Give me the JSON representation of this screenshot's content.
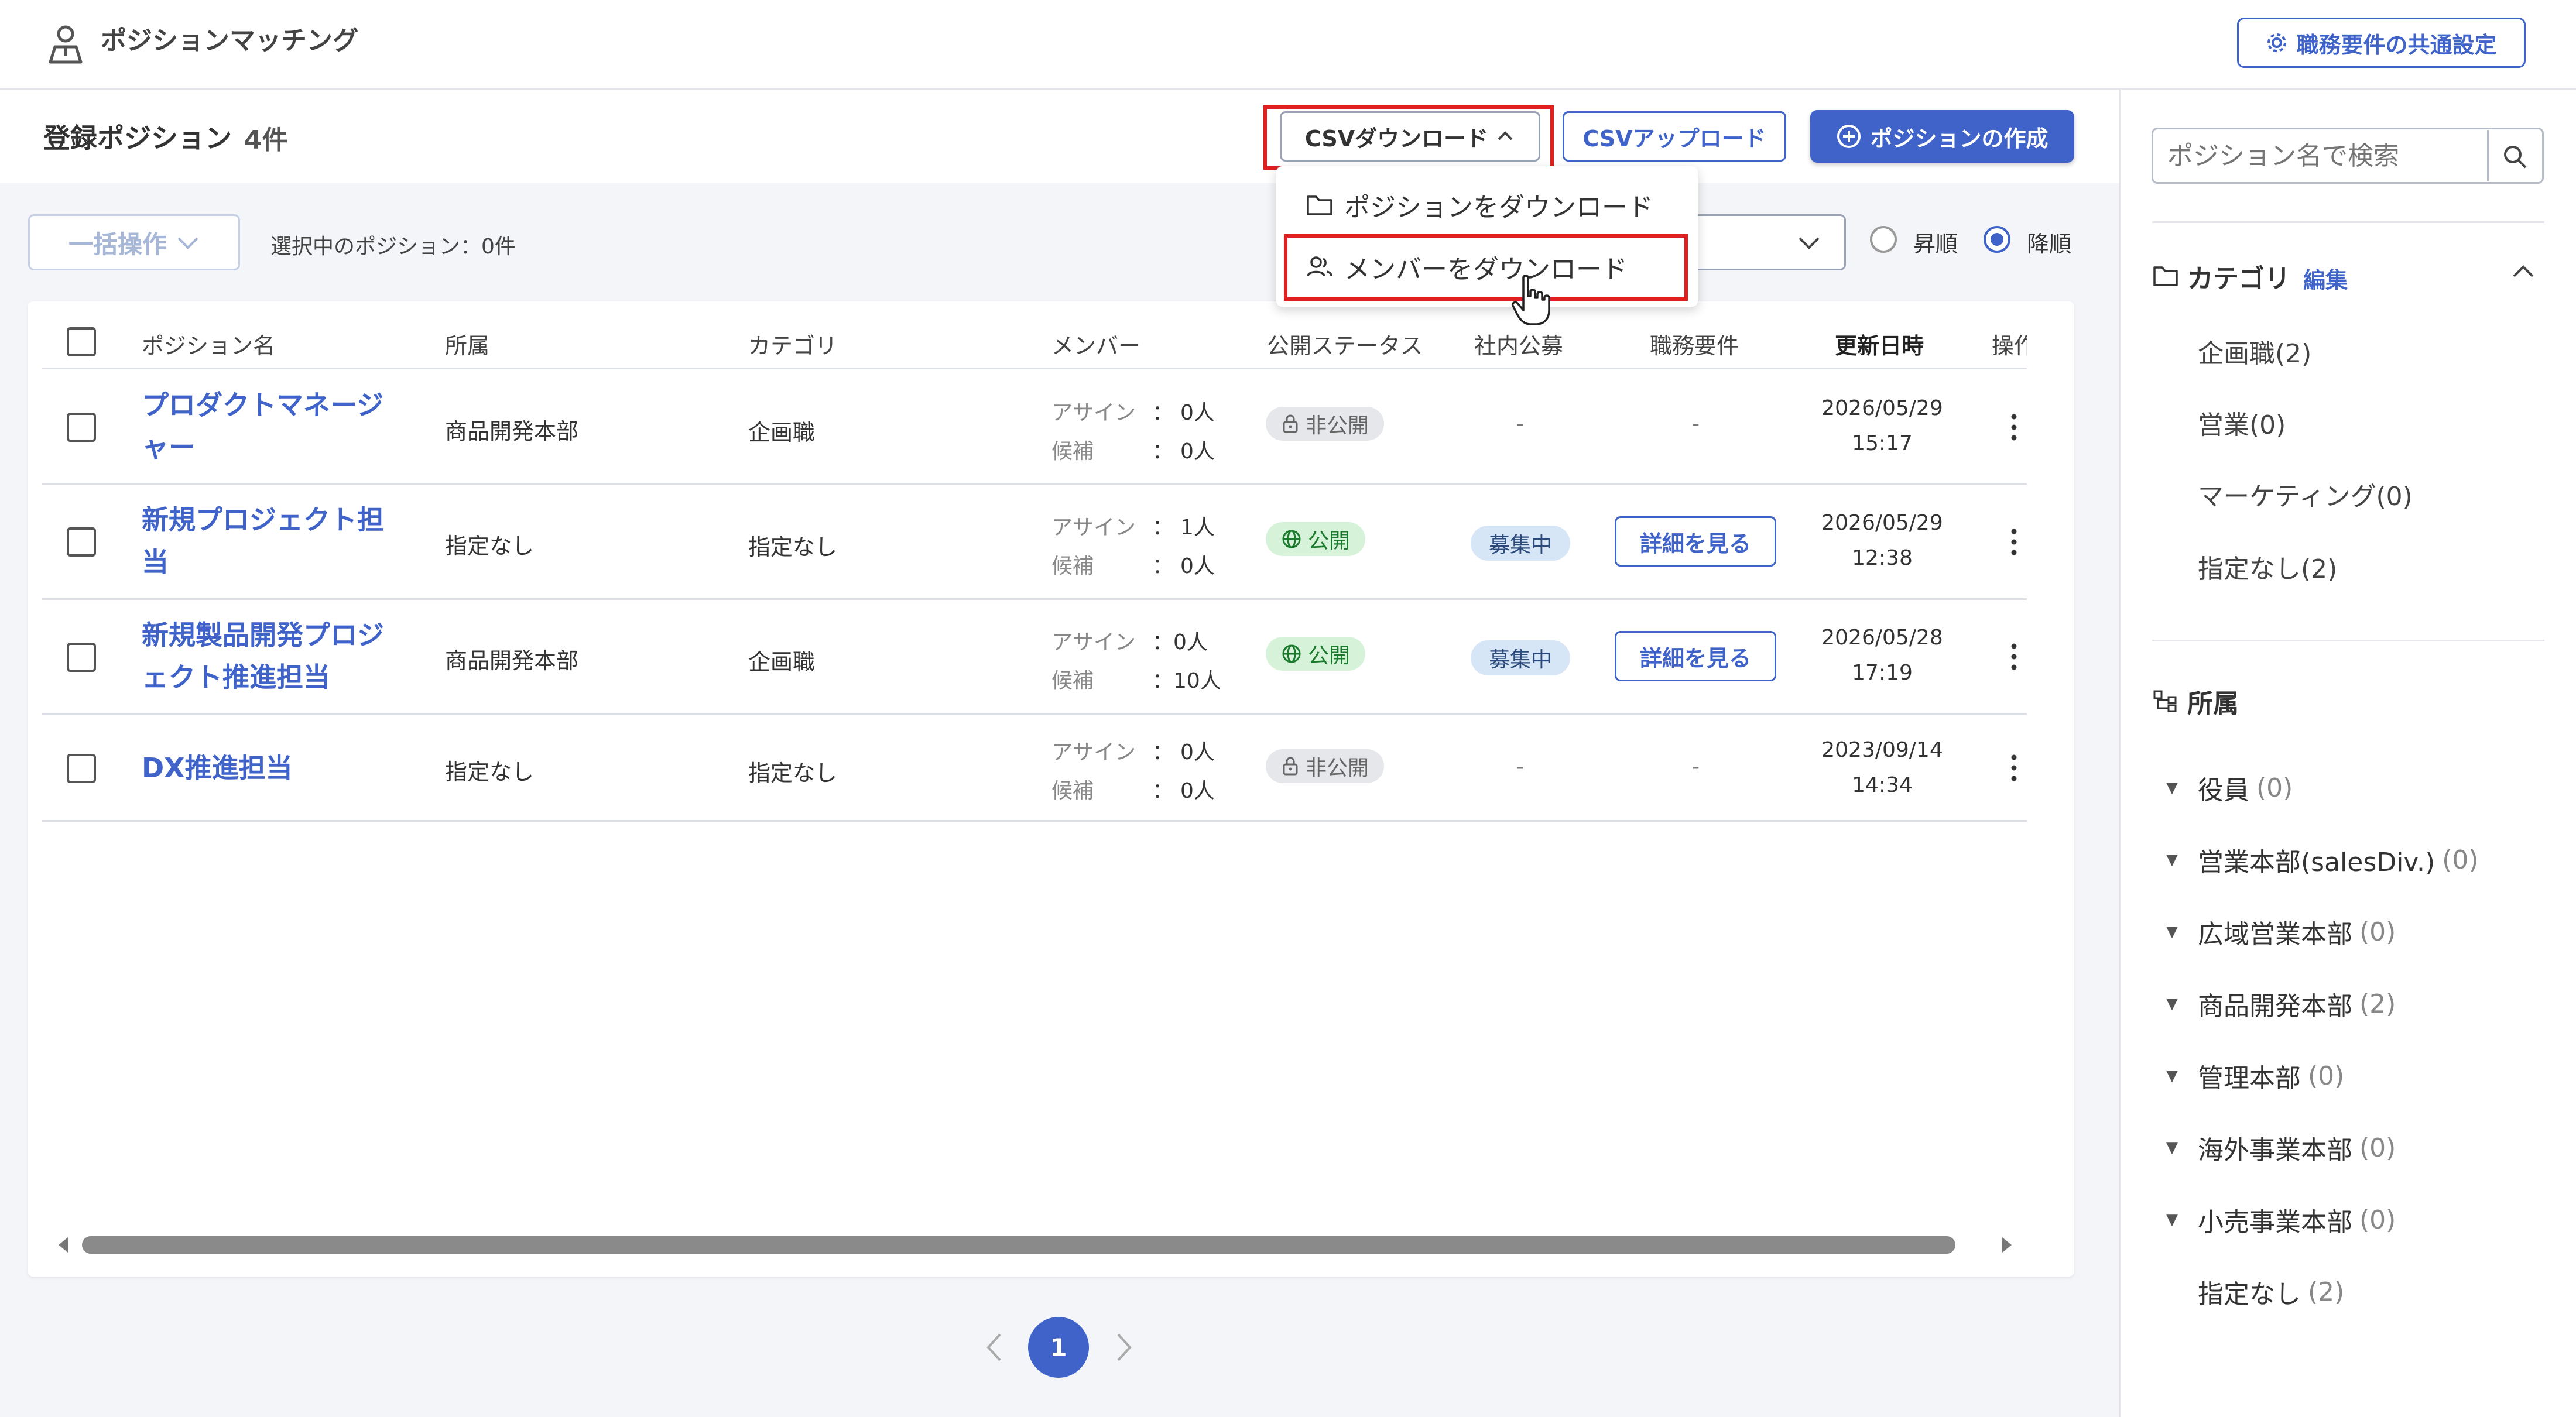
{
  "header": {
    "app_title": "ポジションマッチング",
    "common_settings_label": "職務要件の共通設定"
  },
  "toolbar": {
    "page_title": "登録ポジション",
    "count": "4件",
    "csv_download_label": "CSVダウンロード",
    "csv_upload_label": "CSVアップロード",
    "create_label": "ポジションの作成"
  },
  "dropdown": {
    "items": [
      {
        "label": "ポジションをダウンロード",
        "icon": "folder-icon"
      },
      {
        "label": "メンバーをダウンロード",
        "icon": "users-icon"
      }
    ]
  },
  "bulk": {
    "label": "一括操作",
    "selected_text": "選択中のポジション：0件"
  },
  "sort": {
    "asc_label": "昇順",
    "desc_label": "降順",
    "selected": "desc"
  },
  "table": {
    "headers": [
      "ポジション名",
      "所属",
      "カテゴリ",
      "メンバー",
      "公開ステータス",
      "社内公募",
      "職務要件",
      "更新日時",
      "操作"
    ],
    "member_labels": {
      "assign": "アサイン",
      "candidate": "候補",
      "sep": "："
    },
    "rows": [
      {
        "name": "プロダクトマネージャー",
        "dept": "商品開発本部",
        "category": "企画職",
        "assign": "0人",
        "candidate": "0人",
        "status": "非公開",
        "status_type": "private",
        "recruit": "-",
        "requirement": "-",
        "date": "2026/05/29",
        "time": "15:17"
      },
      {
        "name": "新規プロジェクト担当",
        "dept": "指定なし",
        "category": "指定なし",
        "assign": "1人",
        "candidate": "0人",
        "status": "公開",
        "status_type": "public",
        "recruit": "募集中",
        "requirement": "詳細を見る",
        "date": "2026/05/29",
        "time": "12:38"
      },
      {
        "name": "新規製品開発プロジェクト推進担当",
        "dept": "商品開発本部",
        "category": "企画職",
        "assign": "0人",
        "candidate": "10人",
        "status": "公開",
        "status_type": "public",
        "recruit": "募集中",
        "requirement": "詳細を見る",
        "date": "2026/05/28",
        "time": "17:19"
      },
      {
        "name": "DX推進担当",
        "dept": "指定なし",
        "category": "指定なし",
        "assign": "0人",
        "candidate": "0人",
        "status": "非公開",
        "status_type": "private",
        "recruit": "-",
        "requirement": "-",
        "date": "2023/09/14",
        "time": "14:34"
      }
    ]
  },
  "pagination": {
    "current": "1"
  },
  "sidebar": {
    "search_placeholder": "ポジション名で検索",
    "category_heading": "カテゴリ",
    "category_edit": "編集",
    "categories": [
      "企画職(2)",
      "営業(0)",
      "マーケティング(0)",
      "指定なし(2)"
    ],
    "org_heading": "所属",
    "orgs": [
      {
        "name": "役員",
        "count": "(0)",
        "expandable": true
      },
      {
        "name": "営業本部(salesDiv.)",
        "count": "(0)",
        "expandable": true
      },
      {
        "name": "広域営業本部",
        "count": "(0)",
        "expandable": true
      },
      {
        "name": "商品開発本部",
        "count": "(2)",
        "expandable": true
      },
      {
        "name": "管理本部",
        "count": "(0)",
        "expandable": true
      },
      {
        "name": "海外事業本部",
        "count": "(0)",
        "expandable": true
      },
      {
        "name": "小売事業本部",
        "count": "(0)",
        "expandable": true
      },
      {
        "name": "指定なし",
        "count": "(2)",
        "expandable": false
      }
    ]
  },
  "colors": {
    "accent": "#3f63c8",
    "highlight": "#e02020",
    "public": "#1c7a2c"
  }
}
